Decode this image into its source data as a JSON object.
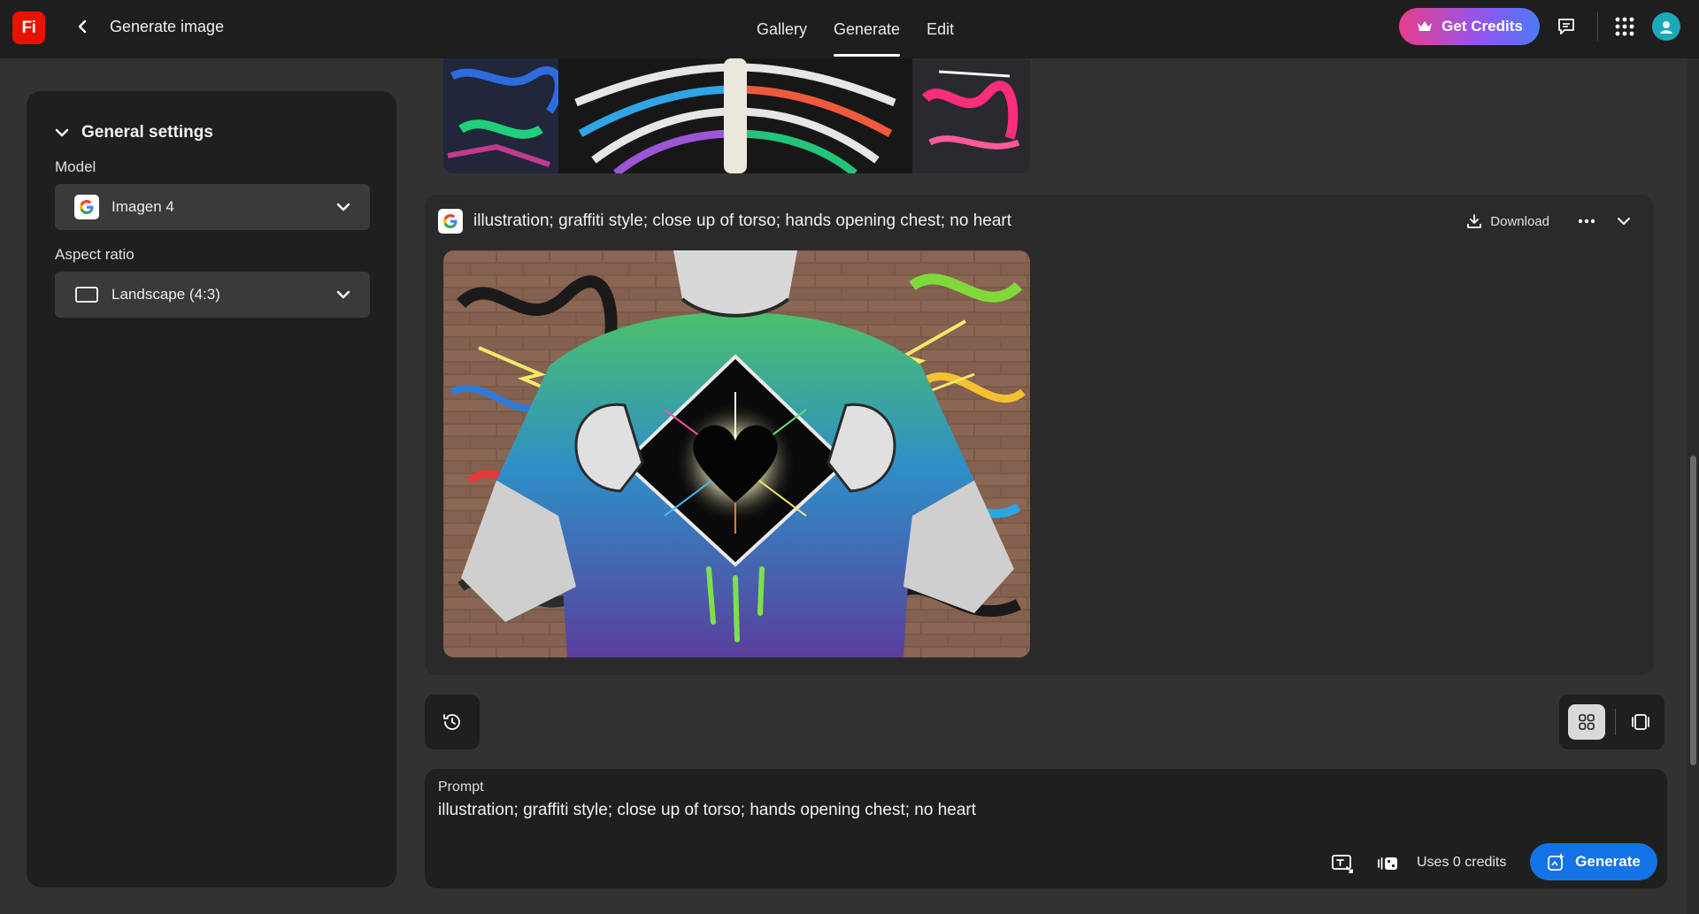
{
  "header": {
    "logo_text": "Fi",
    "title": "Generate image",
    "nav_tabs": [
      {
        "label": "Gallery",
        "active": false
      },
      {
        "label": "Generate",
        "active": true
      },
      {
        "label": "Edit",
        "active": false
      }
    ],
    "credits_button": "Get Credits"
  },
  "settings": {
    "section_title": "General settings",
    "model_label": "Model",
    "model_value": "Imagen 4",
    "aspect_label": "Aspect ratio",
    "aspect_value": "Landscape (4:3)"
  },
  "result": {
    "prompt": "illustration; graffiti style; close up of torso; hands opening chest; no heart",
    "download_label": "Download"
  },
  "prompt_panel": {
    "label": "Prompt",
    "text": "illustration; graffiti style; close up of torso; hands opening chest; no heart",
    "credits_text": "Uses 0 credits",
    "generate_label": "Generate"
  },
  "colors": {
    "accent_blue": "#1473e6",
    "logo_red": "#eb1000",
    "background": "#323232",
    "panel": "#1f1f1f"
  },
  "icons": [
    "back-chevron-icon",
    "crown-icon",
    "feedback-icon",
    "apps-grid-icon",
    "google-icon",
    "chevron-down-icon",
    "landscape-frame-icon",
    "download-icon",
    "more-icon",
    "history-icon",
    "grid-view-icon",
    "single-view-icon",
    "image-reference-icon",
    "style-reference-icon",
    "generate-sparkle-icon"
  ]
}
